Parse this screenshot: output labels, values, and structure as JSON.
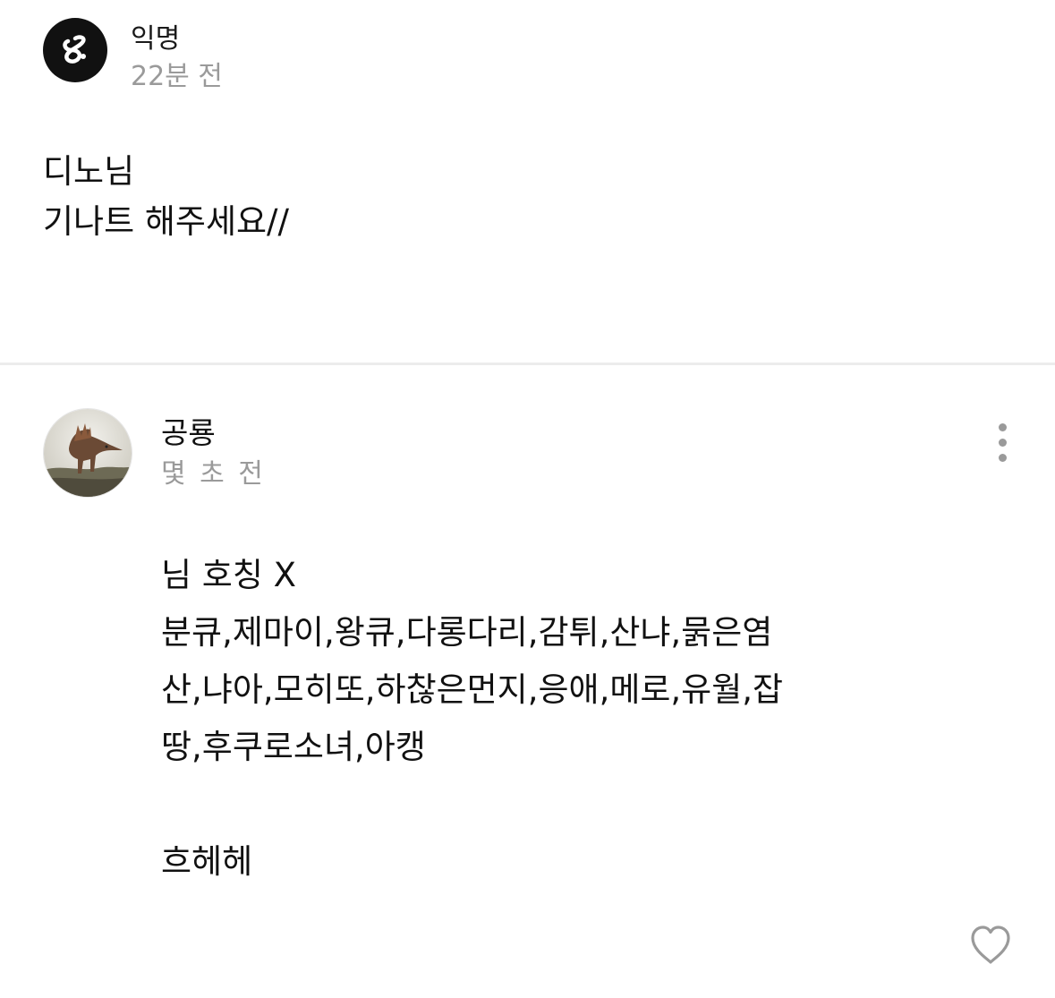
{
  "post": {
    "author": "익명",
    "time": "22분 전",
    "body_lines": [
      "디노님",
      "기나트 해주세요//"
    ]
  },
  "comment": {
    "author": "공룡",
    "time": "몇 초 전",
    "body_lines": [
      "님 호칭 X",
      "분큐,제마이,왕큐,다롱다리,감튀,산냐,묽은염",
      "산,냐아,모히또,하찮은먼지,응애,메로,유월,잡",
      "땅,후쿠로소녀,아캥",
      "",
      "흐헤헤"
    ]
  },
  "icons": {
    "anon_avatar": "anonymous-logo-icon",
    "more": "more-vertical-icon",
    "like": "heart-outline-icon"
  },
  "colors": {
    "text": "#111111",
    "meta": "#9a9a9a",
    "divider": "#ececec"
  }
}
